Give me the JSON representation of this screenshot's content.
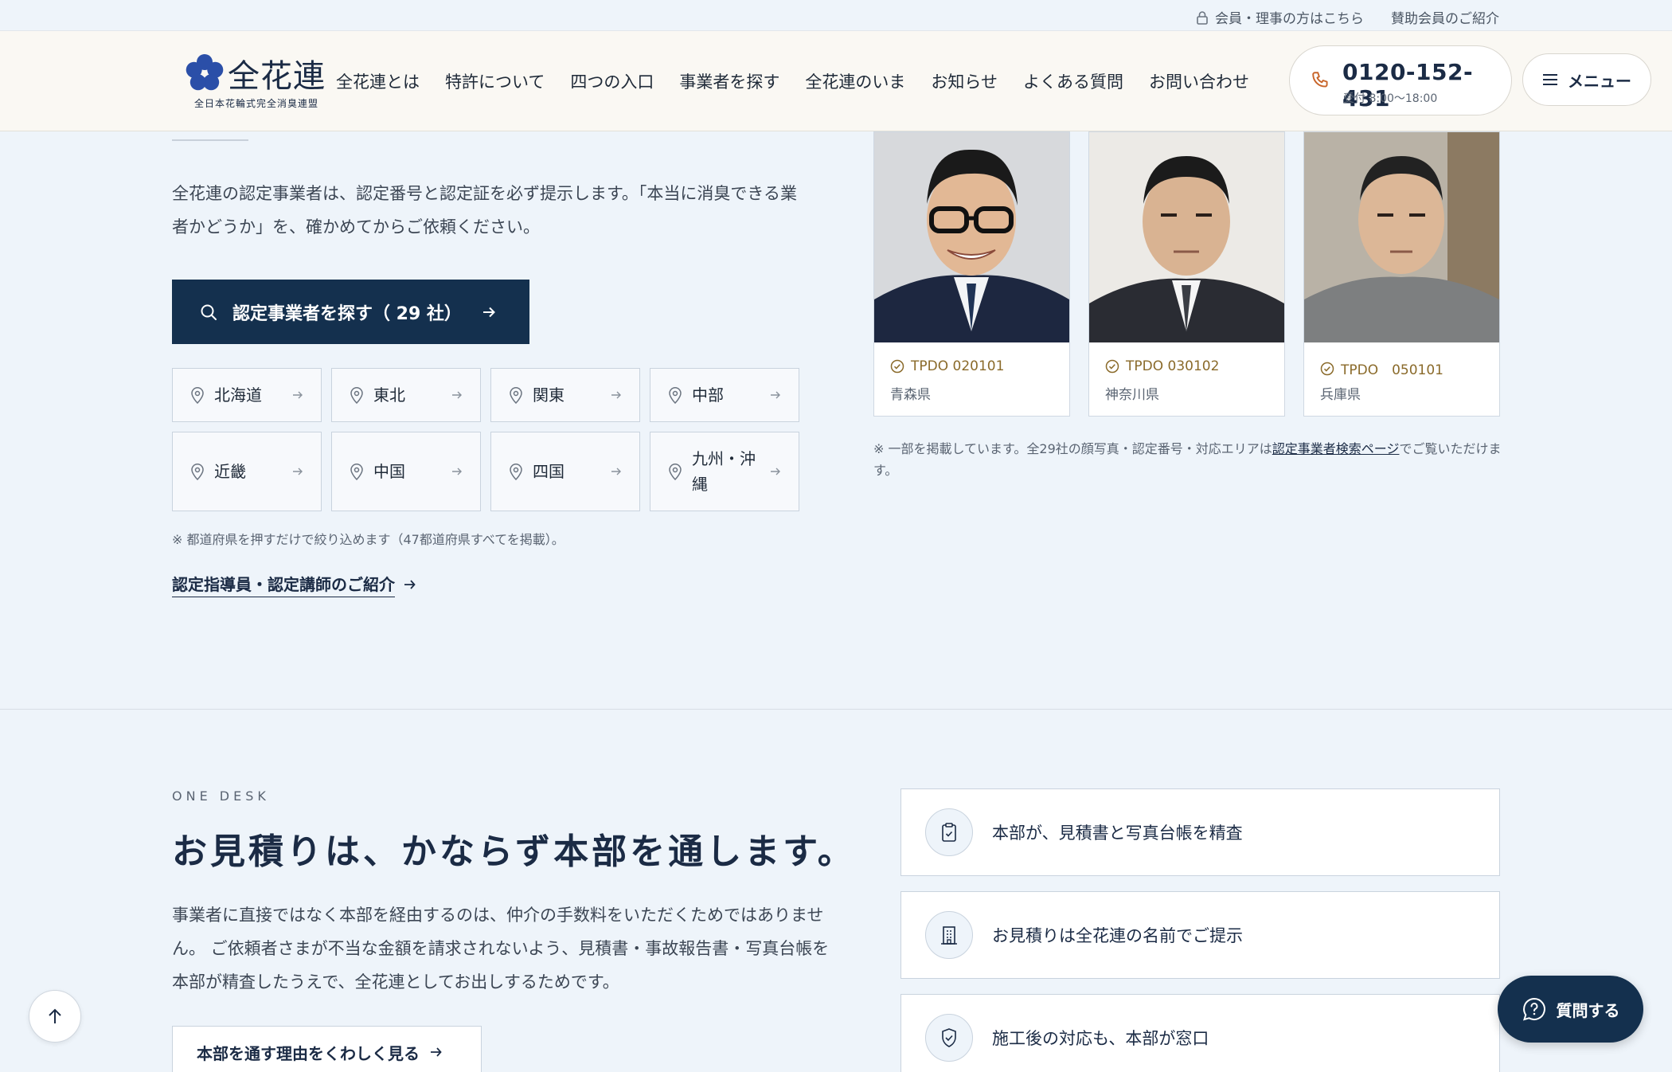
{
  "utility": {
    "member_link": "会員・理事の方はこちら",
    "sponsor_link": "賛助会員のご紹介"
  },
  "header": {
    "logo_name": "全花連",
    "logo_sub": "全日本花輪式完全消臭連盟",
    "nav": [
      "全花連とは",
      "特許について",
      "四つの入口",
      "事業者を探す",
      "全花連のいま",
      "お知らせ",
      "よくある質問",
      "お問い合わせ"
    ],
    "phone_number": "0120-152-431",
    "phone_hours": "受付 8:00〜18:00",
    "menu_label": "メニュー"
  },
  "section1": {
    "intro": "全花連の認定事業者は、認定番号と認定証を必ず提示します。「本当に消臭できる業者かどうか」を、確かめてからご依頼ください。",
    "search_button": "認定事業者を探す（ 29 社）",
    "regions": [
      "北海道",
      "東北",
      "関東",
      "中部",
      "近畿",
      "中国",
      "四国",
      "九州・沖縄"
    ],
    "region_note": "※ 都道府県を押すだけで絞り込めます（47都道府県すべてを掲載）。",
    "instructor_link": "認定指導員・認定講師のご紹介",
    "cards": [
      {
        "code": "TPDO 020101",
        "pref": "青森県"
      },
      {
        "code": "TPDO 030102",
        "pref": "神奈川県"
      },
      {
        "code": "TPDO　050101",
        "pref": "兵庫県"
      }
    ],
    "cards_note_pre": "※ 一部を掲載しています。全29社の顔写真・認定番号・対応エリアは",
    "cards_note_link": "認定事業者検索ページ",
    "cards_note_post": "でご覧いただけます。"
  },
  "section2": {
    "eyebrow": "ONE DESK",
    "heading": "お見積りは、かならず本部を通します。",
    "body": "事業者に直接ではなく本部を経由するのは、仲介の手数料をいただくためではありません。 ご依頼者さまが不当な金額を請求されないよう、見積書・事故報告書・写真台帳を 本部が精査したうえで、全花連としてお出しするためです。",
    "reason_button": "本部を通す理由をくわしく見る",
    "features": [
      {
        "icon": "clipboard-check-icon",
        "text": "本部が、見積書と写真台帳を精査"
      },
      {
        "icon": "building-icon",
        "text": "お見積りは全花連の名前でご提示"
      },
      {
        "icon": "shield-check-icon",
        "text": "施工後の対応も、本部が窓口"
      }
    ]
  },
  "floating": {
    "ask_button": "質問する"
  },
  "colors": {
    "navy": "#14304e",
    "page_bg": "#eef4fa",
    "header_bg": "#faf8f3",
    "gold": "#8a6a2a",
    "phone_icon": "#c8652a"
  }
}
